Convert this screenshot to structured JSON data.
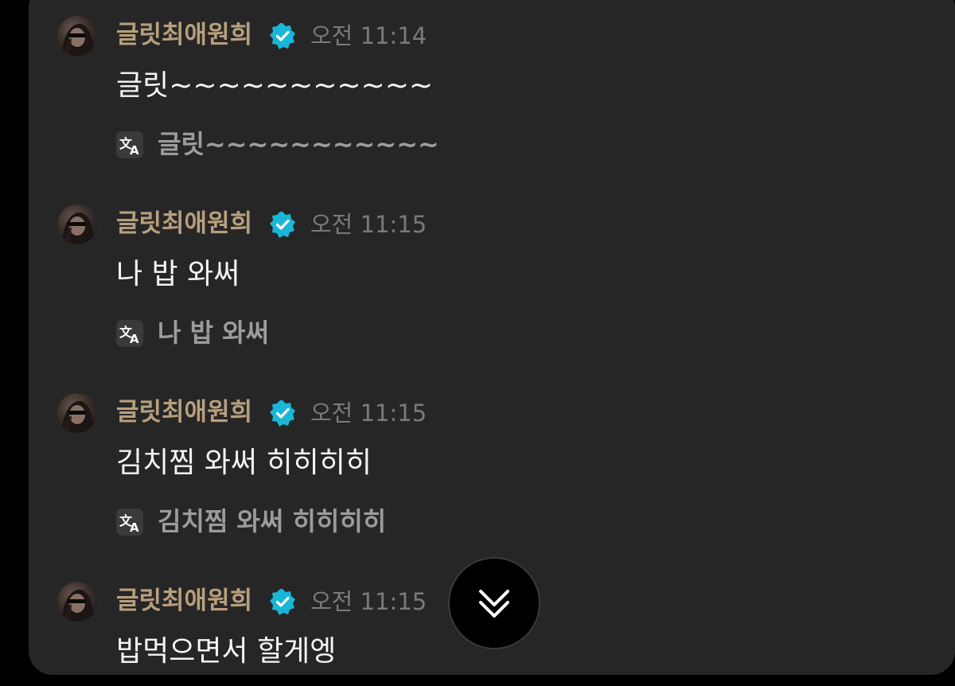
{
  "messages": [
    {
      "author": "글릿최애원희",
      "time": "오전 11:14",
      "text": "글릿~~~~~~~~~~~",
      "translation": "글릿~~~~~~~~~~~"
    },
    {
      "author": "글릿최애원희",
      "time": "오전 11:15",
      "text": "나 밥 와써",
      "translation": "나 밥 와써"
    },
    {
      "author": "글릿최애원희",
      "time": "오전 11:15",
      "text": "김치찜 와써 히히히히",
      "translation": "김치찜 와써 히히히히"
    },
    {
      "author": "글릿최애원희",
      "time": "오전 11:15",
      "text": "밥먹으면서 할게엥"
    }
  ],
  "colors": {
    "panel_bg": "#262626",
    "author": "#b79f7d",
    "verified_badge": "#19b6d6",
    "time": "#7a7a7a",
    "message_text": "#f4f4f4",
    "translation_text": "#9c9c9c"
  },
  "icons": {
    "verified": "verified-badge-icon",
    "translate": "translate-icon",
    "scroll_down": "double-chevron-down-icon"
  }
}
